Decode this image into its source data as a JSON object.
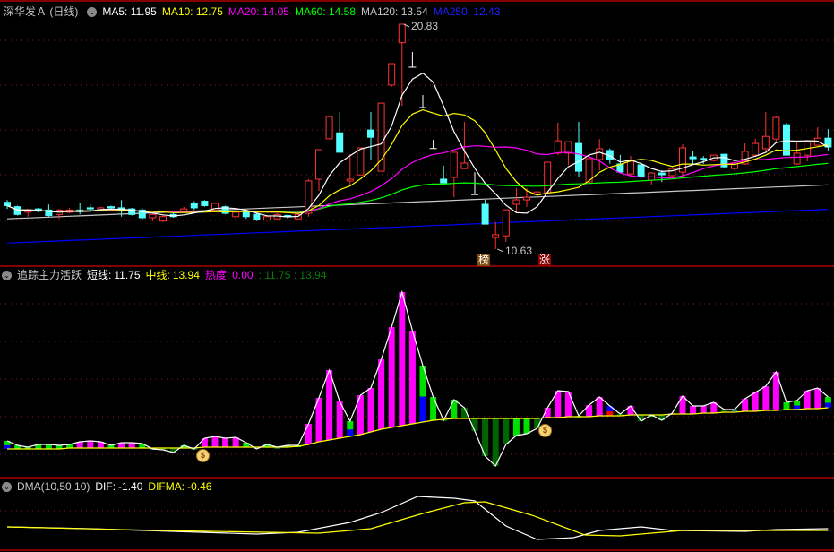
{
  "header": {
    "title": "深华发Ａ (日线)",
    "ma": [
      {
        "label": "MA5:",
        "value": "11.95",
        "color": "#ffffff"
      },
      {
        "label": "MA10:",
        "value": "12.75",
        "color": "#ffff00"
      },
      {
        "label": "MA20:",
        "value": "14.05",
        "color": "#ff00ff"
      },
      {
        "label": "MA60:",
        "value": "14.58",
        "color": "#00ff00"
      },
      {
        "label": "MA120:",
        "value": "13.54",
        "color": "#c8c8c8"
      },
      {
        "label": "MA250:",
        "value": "12.43",
        "color": "#0000ff"
      }
    ]
  },
  "indicator": {
    "name": "追踪主力活跃",
    "short_label": "短线:",
    "short_value": "11.75",
    "mid_label": "中线:",
    "mid_value": "13.94",
    "heat_label": "热度:",
    "heat_value": "0.00",
    "extra": ": 11.75 : 13.94"
  },
  "dma": {
    "name": "DMA(10,50,10)",
    "dif_label": "DIF:",
    "dif_value": "-1.40",
    "difma_label": "DIFMA:",
    "difma_value": "-0.46"
  },
  "markers": {
    "list_label": "榜",
    "limit_up_label": "涨",
    "high_label": "20.83",
    "low_label": "10.63"
  },
  "colors": {
    "up": "#ff3232",
    "down": "#54ffff",
    "grid": "#8b1a1a",
    "separator": "#b00000"
  },
  "chart_data": [
    {
      "type": "candlestick",
      "ylim": [
        10.2,
        21.6
      ],
      "candles": [
        [
          12.75,
          12.6,
          12.85,
          12.45
        ],
        [
          12.55,
          12.2,
          12.6,
          12.15
        ],
        [
          12.3,
          12.4,
          12.45,
          12.1
        ],
        [
          12.45,
          12.35,
          12.5,
          12.3
        ],
        [
          12.4,
          12.15,
          12.65,
          12.1
        ],
        [
          12.2,
          12.4,
          12.45,
          12.0
        ],
        [
          12.3,
          12.4,
          12.5,
          12.25
        ],
        [
          12.4,
          12.35,
          12.7,
          12.2
        ],
        [
          12.5,
          12.45,
          12.65,
          12.3
        ],
        [
          12.4,
          12.5,
          12.55,
          12.35
        ],
        [
          12.55,
          12.5,
          12.6,
          12.4
        ],
        [
          12.5,
          12.35,
          12.85,
          12.1
        ],
        [
          12.45,
          12.2,
          12.5,
          12.15
        ],
        [
          12.4,
          12.05,
          12.5,
          11.95
        ],
        [
          12.05,
          12.2,
          12.25,
          11.9
        ],
        [
          11.9,
          12.1,
          12.15,
          11.85
        ],
        [
          12.2,
          12.1,
          12.3,
          12.05
        ],
        [
          12.3,
          12.45,
          12.55,
          12.25
        ],
        [
          12.7,
          12.5,
          12.8,
          12.4
        ],
        [
          12.8,
          12.6,
          12.85,
          12.55
        ],
        [
          12.4,
          12.7,
          12.75,
          12.35
        ],
        [
          12.55,
          12.25,
          12.6,
          12.2
        ],
        [
          12.1,
          12.3,
          12.35,
          12.0
        ],
        [
          12.3,
          12.1,
          12.35,
          12.0
        ],
        [
          12.2,
          11.95,
          12.25,
          11.9
        ],
        [
          11.95,
          12.1,
          12.15,
          11.9
        ],
        [
          12.0,
          12.2,
          12.25,
          11.95
        ],
        [
          12.15,
          12.1,
          12.2,
          12.0
        ],
        [
          12.0,
          12.2,
          12.25,
          11.95
        ],
        [
          12.25,
          13.72,
          13.8,
          12.1
        ],
        [
          13.8,
          15.14,
          15.14,
          13.27
        ],
        [
          15.63,
          16.64,
          16.64,
          15.63
        ],
        [
          15.9,
          15.02,
          16.85,
          15.02
        ],
        [
          13.72,
          13.8,
          14.93,
          13.51
        ],
        [
          13.99,
          15.22,
          15.22,
          13.99
        ],
        [
          16.03,
          15.7,
          16.85,
          14.69
        ],
        [
          14.16,
          17.25,
          17.25,
          14.16
        ],
        [
          18.07,
          19.04,
          19.04,
          17.99
        ],
        [
          19.99,
          20.83,
          20.83,
          17.13
        ],
        [
          18.88,
          18.88,
          19.57,
          18.88
        ],
        [
          17.05,
          17.05,
          17.62,
          17.05
        ],
        [
          15.19,
          15.19,
          15.58,
          15.19
        ],
        [
          13.8,
          13.63,
          14.41,
          13.63
        ],
        [
          13.88,
          15.02,
          15.02,
          12.98
        ],
        [
          14.28,
          14.53,
          16.4,
          14.28
        ],
        [
          13.1,
          13.1,
          14.12,
          13.1
        ],
        [
          12.66,
          11.76,
          12.86,
          11.76
        ],
        [
          11.15,
          11.28,
          11.85,
          10.63
        ],
        [
          11.23,
          12.41,
          12.41,
          10.95
        ],
        [
          12.66,
          12.86,
          13.4,
          12.25
        ],
        [
          12.86,
          12.98,
          13.39,
          12.55
        ],
        [
          13.1,
          13.22,
          13.3,
          12.85
        ],
        [
          13.18,
          14.57,
          14.57,
          13.1
        ],
        [
          14.98,
          15.54,
          16.36,
          14.9
        ],
        [
          14.98,
          15.5,
          15.5,
          14.45
        ],
        [
          15.42,
          14.16,
          16.4,
          13.92
        ],
        [
          13.67,
          14.73,
          14.98,
          13.26
        ],
        [
          14.69,
          15.18,
          15.62,
          14.2
        ],
        [
          15.1,
          14.69,
          15.2,
          14.5
        ],
        [
          14.49,
          14.12,
          14.9,
          14.1
        ],
        [
          14.04,
          14.61,
          14.85,
          13.92
        ],
        [
          14.45,
          13.92,
          14.73,
          13.92
        ],
        [
          13.75,
          14.08,
          14.12,
          13.51
        ],
        [
          14.08,
          14.0,
          14.2,
          13.67
        ],
        [
          13.96,
          14.28,
          14.35,
          13.9
        ],
        [
          14.12,
          15.22,
          15.38,
          13.92
        ],
        [
          14.81,
          14.73,
          15.06,
          14.49
        ],
        [
          14.74,
          14.72,
          14.85,
          14.49
        ],
        [
          14.65,
          14.89,
          14.9,
          14.6
        ],
        [
          14.93,
          14.36,
          14.95,
          14.3
        ],
        [
          14.28,
          14.49,
          14.5,
          14.2
        ],
        [
          14.49,
          15.06,
          15.42,
          14.45
        ],
        [
          14.89,
          15.42,
          15.62,
          14.85
        ],
        [
          15.18,
          15.74,
          16.84,
          15.1
        ],
        [
          15.62,
          16.6,
          16.68,
          15.5
        ],
        [
          16.27,
          14.89,
          16.36,
          14.89
        ],
        [
          14.49,
          14.98,
          15.46,
          14.45
        ],
        [
          14.89,
          15.5,
          15.5,
          14.61
        ],
        [
          15.34,
          15.66,
          16.15,
          15.3
        ],
        [
          15.66,
          15.26,
          16.07,
          15.1
        ]
      ],
      "ma120": [
        12.0,
        13.54
      ],
      "ma250": [
        10.9,
        12.43
      ],
      "high": {
        "index": 38,
        "value": 20.83
      },
      "low": {
        "index": 47,
        "value": 10.63
      }
    },
    {
      "type": "bar",
      "ylim": [
        -11.5,
        98.5
      ],
      "top": [
        7.5,
        5,
        4,
        5.5,
        5.5,
        5,
        5.5,
        7,
        7.5,
        7,
        5,
        6.5,
        6.5,
        6,
        3,
        2.5,
        1,
        5,
        3,
        9,
        10,
        9,
        9.5,
        6.5,
        3,
        5.5,
        4,
        5,
        5,
        17,
        31.5,
        47,
        29.5,
        18.5,
        33,
        37,
        53,
        71,
        90.5,
        69,
        49.5,
        32,
        19,
        30.5,
        26,
        13,
        -1,
        -6.5,
        5.5,
        10.5,
        11.5,
        14.5,
        26,
        35.5,
        35,
        21.5,
        27.5,
        32,
        27,
        22.5,
        27,
        18.5,
        22,
        19,
        23,
        32.5,
        27,
        27,
        29,
        25,
        25,
        31,
        34.5,
        38,
        46,
        29,
        30,
        35.5,
        37,
        32
      ],
      "base": [
        3,
        3,
        3,
        3,
        3,
        3,
        3.5,
        3.5,
        3.5,
        3.5,
        3.5,
        3.5,
        3.5,
        3.5,
        3.5,
        3.5,
        3.5,
        3.5,
        3.5,
        4,
        4,
        4,
        4,
        4,
        4,
        4,
        4,
        4,
        4.5,
        5.5,
        7,
        8,
        9,
        10,
        11,
        12.5,
        14,
        15,
        16,
        17,
        18,
        19,
        19.5,
        20,
        20,
        20,
        20,
        20,
        20,
        20,
        20,
        20,
        20.5,
        20.5,
        21,
        21,
        21,
        21.5,
        21.5,
        21.5,
        22,
        22,
        22,
        22,
        22.5,
        22.5,
        22.5,
        23,
        23,
        23.5,
        23.5,
        24,
        24,
        24.5,
        24.5,
        25,
        25,
        25.5,
        25.5,
        26
      ],
      "colors": [
        "gb",
        "g",
        "g",
        "g",
        "g",
        "g",
        "g",
        "m",
        "m",
        "m",
        "g",
        "m",
        "m",
        "g",
        "d",
        "d",
        "d",
        "g",
        "d",
        "m",
        "m",
        "m",
        "m",
        "g",
        "d",
        "g",
        "d",
        "g",
        "g",
        "m",
        "m",
        "m",
        "m",
        "gb",
        "m",
        "m",
        "m",
        "m",
        "m",
        "m",
        "gb",
        "g",
        "d",
        "g",
        "d",
        "d",
        "d",
        "d",
        "d",
        "g",
        "g",
        "d",
        "m",
        "m",
        "m",
        "d",
        "m",
        "m",
        "br",
        "d",
        "m",
        "d",
        "g",
        "d",
        "br",
        "m",
        "m",
        "m",
        "m",
        "d",
        "gb",
        "m",
        "m",
        "m",
        "m",
        "g",
        "gb",
        "m",
        "m",
        "gb"
      ],
      "signals": [
        19,
        52
      ]
    },
    {
      "type": "line",
      "ylim": [
        -2.8,
        4.8
      ],
      "series": [
        {
          "name": "DIF",
          "color": "#ffffff",
          "points": [
            [
              0,
              0
            ],
            [
              8,
              -0.2
            ],
            [
              24,
              -0.8
            ],
            [
              28,
              -0.6
            ],
            [
              33,
              0.5
            ],
            [
              36,
              1.6
            ],
            [
              39.5,
              3.4
            ],
            [
              43,
              3.2
            ],
            [
              45,
              2.9
            ],
            [
              48,
              0.1
            ],
            [
              51,
              -1.4
            ],
            [
              54.5,
              -1.2
            ],
            [
              57,
              -0.4
            ],
            [
              61,
              0
            ],
            [
              64,
              -0.4
            ],
            [
              71,
              -0.5
            ],
            [
              74,
              -0.3
            ],
            [
              79,
              -0.2
            ]
          ]
        },
        {
          "name": "DIFMA",
          "color": "#ffff00",
          "points": [
            [
              0,
              0
            ],
            [
              14.7,
              -0.4
            ],
            [
              30,
              -0.7
            ],
            [
              35,
              -0.2
            ],
            [
              40,
              1.5
            ],
            [
              44,
              2.7
            ],
            [
              46,
              2.8
            ],
            [
              50.5,
              1.3
            ],
            [
              55.6,
              -0.9
            ],
            [
              59,
              -1.0
            ],
            [
              65,
              -0.4
            ],
            [
              79,
              -0.4
            ]
          ]
        }
      ]
    }
  ]
}
